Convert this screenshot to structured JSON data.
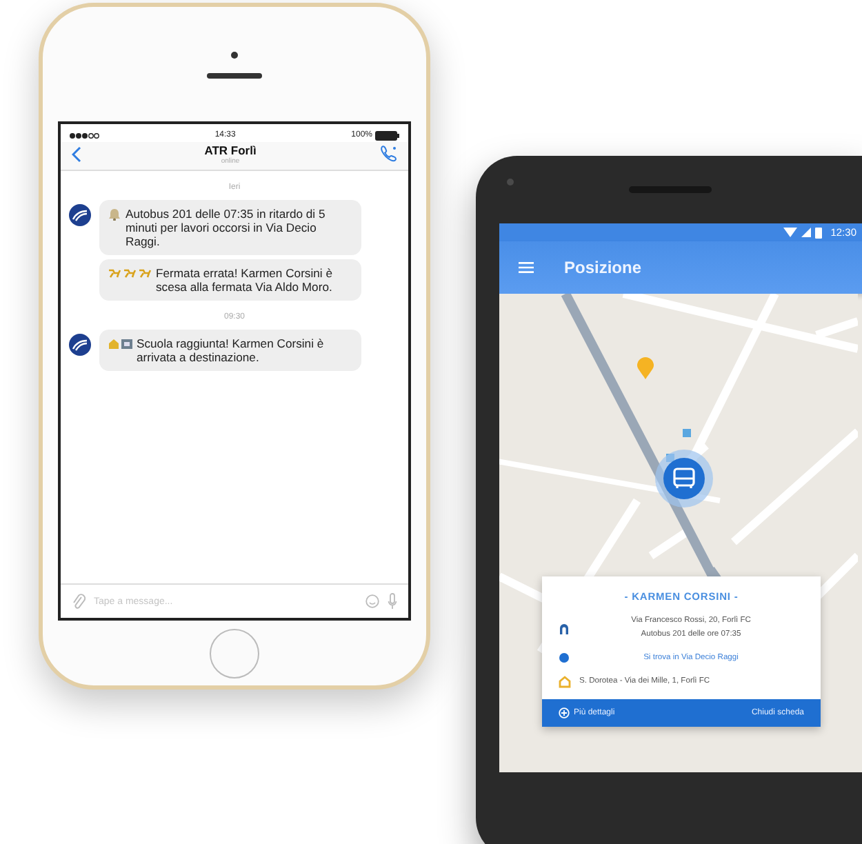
{
  "iphone_chat": {
    "status_bar": {
      "time": "14:33",
      "battery": "100%"
    },
    "header": {
      "title": "ATR Forlì",
      "subtitle": "online"
    },
    "messages": [
      {
        "kind": "divider",
        "text": "Ieri"
      },
      {
        "kind": "group",
        "bubbles": [
          {
            "kind": "delay",
            "text": "Autobus 201 delle 07:35 in ritardo di 5 minuti per lavori occorsi in Via Decio Raggi."
          },
          {
            "kind": "wrong_stop",
            "text": "Fermata errata! Karmen Corsini è scesa alla fermata Via Aldo Moro."
          }
        ]
      },
      {
        "kind": "divider",
        "text": "09:30"
      },
      {
        "kind": "group",
        "bubbles": [
          {
            "kind": "arrival",
            "text": "Scuola raggiunta! Karmen Corsini è arrivata a destinazione."
          }
        ]
      }
    ],
    "composer": {
      "placeholder": "Tape a message..."
    }
  },
  "android_app": {
    "status_bar": {
      "time": "12:30"
    },
    "app_bar": {
      "title": "Posizione"
    },
    "card": {
      "title": "- KARMEN CORSINI -",
      "rows": [
        {
          "kind": "home",
          "lines": [
            "Via Francesco Rossi, 20,  Forlì FC",
            "Autobus 201 delle ore 07:35"
          ]
        },
        {
          "kind": "current",
          "lines": [
            "Si trova in Via Decio Raggi"
          ]
        },
        {
          "kind": "school",
          "lines": [
            "S. Dorotea - Via dei Mille, 1, Forlì FC"
          ]
        }
      ],
      "actions": [
        {
          "kind": "details",
          "label": "Più dettagli"
        },
        {
          "kind": "close",
          "label": "Chiudi scheda"
        }
      ]
    }
  }
}
